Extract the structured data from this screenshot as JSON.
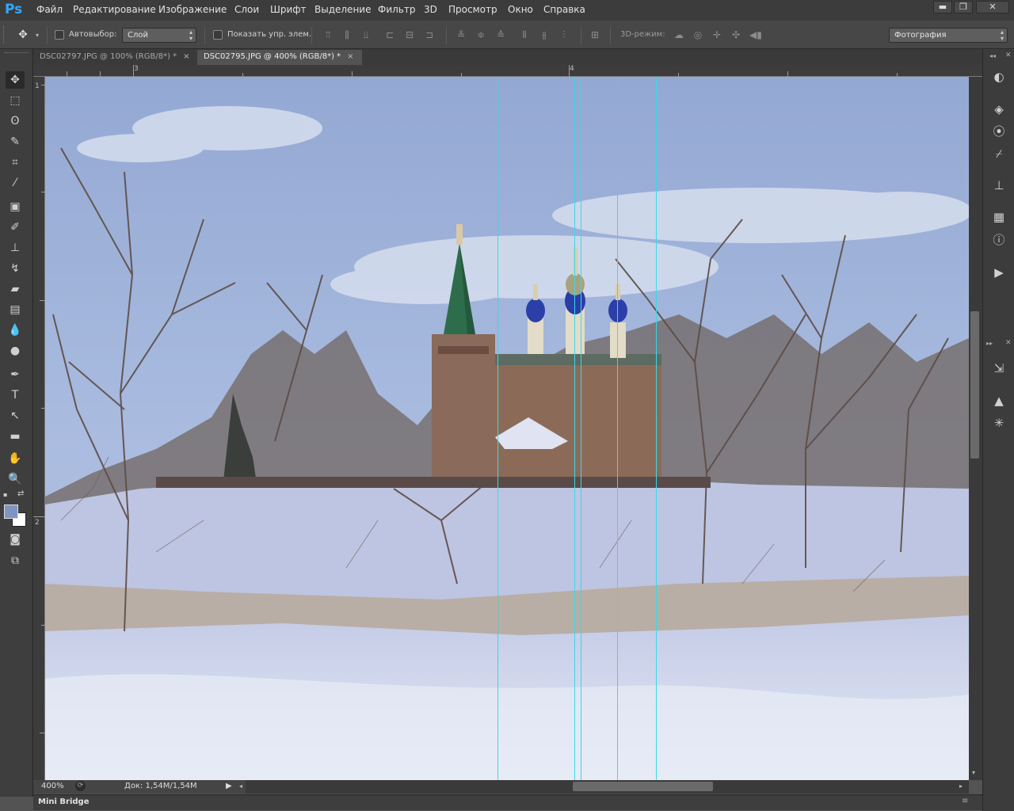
{
  "app": {
    "logo": "Ps"
  },
  "menu": [
    "Файл",
    "Редактирование",
    "Изображение",
    "Слои",
    "Шрифт",
    "Выделение",
    "Фильтр",
    "3D",
    "Просмотр",
    "Окно",
    "Справка"
  ],
  "window_controls": {
    "minimize": "▬",
    "restore": "❐",
    "close": "✕"
  },
  "options": {
    "autoselect_label": "Автовыбор:",
    "autoselect_value": "Слой",
    "show_controls_label": "Показать упр. элем.",
    "mode3d_label": "3D-режим:",
    "workspace_value": "Фотография"
  },
  "tabs": [
    {
      "label": "DSC02797.JPG @ 100% (RGB/8*) *",
      "close": "×",
      "active": false
    },
    {
      "label": "DSC02795.JPG @ 400% (RGB/8*) *",
      "close": "×",
      "active": true
    }
  ],
  "ruler": {
    "top_labels": [
      "3",
      "4"
    ],
    "left_labels": [
      "1",
      "2"
    ]
  },
  "status": {
    "zoom": "400%",
    "doc": "Док: 1,54M/1,54M"
  },
  "bottom_panel": {
    "label": "Mini Bridge"
  },
  "tools": [
    "move-tool",
    "marquee-tool",
    "lasso-tool",
    "quick-select-tool",
    "crop-tool",
    "eyedropper-tool",
    "healing-brush-tool",
    "brush-tool",
    "stamp-tool",
    "history-brush-tool",
    "eraser-tool",
    "gradient-tool",
    "blur-tool",
    "dodge-tool",
    "pen-tool",
    "type-tool",
    "path-select-tool",
    "rectangle-tool",
    "hand-tool",
    "zoom-tool"
  ],
  "colors": {
    "foreground": "#7f96c4",
    "background": "#ffffff",
    "guide": "#39d9e8",
    "accent": "#31a8ff"
  }
}
